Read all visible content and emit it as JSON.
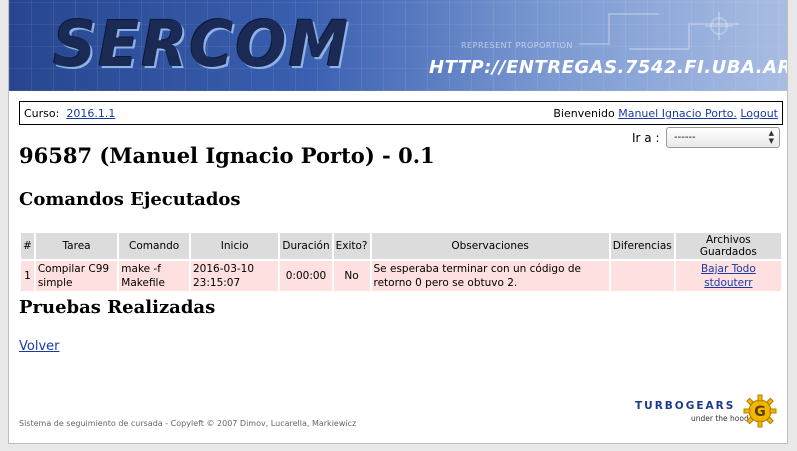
{
  "banner": {
    "logo": "SERCOM",
    "url": "HTTP://ENTREGAS.7542.FI.UBA.AR",
    "fineprint": "REPRESENT PROPORTION"
  },
  "userbar": {
    "course_label": "Curso:",
    "course_link": "2016.1.1",
    "welcome_label": "Bienvenido",
    "user_link": "Manuel Ignacio Porto.",
    "logout_link": "Logout"
  },
  "goto": {
    "label": "Ir a :",
    "selected": "------"
  },
  "page": {
    "title": "96587 (Manuel Ignacio Porto) - 0.1",
    "commands_heading": "Comandos Ejecutados",
    "tests_heading": "Pruebas Realizadas",
    "back_link": "Volver"
  },
  "table": {
    "headers": [
      "#",
      "Tarea",
      "Comando",
      "Inicio",
      "Duración",
      "Exito?",
      "Observaciones",
      "Diferencias",
      "Archivos Guardados"
    ],
    "rows": [
      {
        "num": "1",
        "tarea": "Compilar C99 simple",
        "comando": "make -f Makefile",
        "inicio": "2016-03-10 23:15:07",
        "duracion": "0:00:00",
        "exito": "No",
        "observaciones": "Se esperaba terminar con un código de retorno 0 pero se obtuvo 2.",
        "diferencias": "",
        "archivos_link1": "Bajar Todo",
        "archivos_link2": "stdouterr"
      }
    ]
  },
  "footer": {
    "text": "Sistema de seguimiento de cursada - Copyleft © 2007 Dimov, Lucarella, Markiewicz"
  },
  "powered": {
    "name": "TURBOGEARS",
    "tagline": "under the hood"
  },
  "colors": {
    "row_bg": "#ffe0e0",
    "header_bg": "#dcdcdc",
    "link": "#1a3aa6",
    "banner_dark": "#27468f"
  }
}
